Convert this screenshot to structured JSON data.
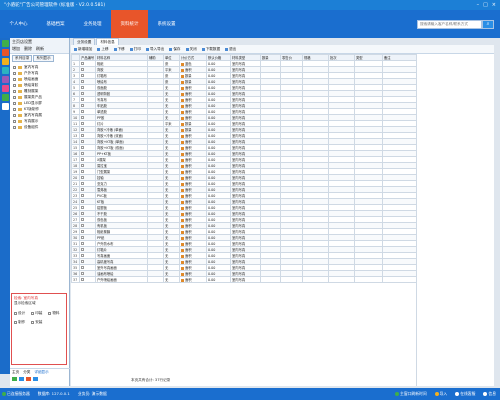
{
  "title": "\"小骆驼\"广告公司管理软件 (标准版 - V2.0.0.581)",
  "nav_tabs": [
    "个人中心",
    "基础档案",
    "业务处理",
    "资料统计",
    "系统设置"
  ],
  "nav_active": 3,
  "search_placeholder": "搜索请输入客户名称/联系方式",
  "left_toolbar": [
    "主页店设置",
    "增加",
    "删除",
    "刷新"
  ],
  "left_tabs": [
    "系列目录",
    "系列显示"
  ],
  "tree_items": [
    "室内写真",
    "户外写真",
    "喷绘画面",
    "喷绘背胶",
    "雕刻展架",
    "展架类产品",
    "LED显示屏",
    "KT版制作",
    "室内写真展",
    "写真展示",
    "设备组件"
  ],
  "filter": {
    "heading": "检索: 室内写真",
    "sub": "显示检索区域",
    "options": [
      "设计",
      "印装",
      "物料",
      "制作",
      "安装"
    ]
  },
  "left_bottom_tabs": [
    "主页",
    "分类",
    "详细显示"
  ],
  "doc_tabs": [
    "业务设置",
    "材料信息"
  ],
  "toolbar_items": [
    "新增增加",
    "上移",
    "下移",
    "打印",
    "导入导出",
    "保存",
    "关闭",
    "下载数据",
    "退出"
  ],
  "columns": [
    "",
    "产品编号",
    "材料名称",
    "辅助",
    "单位",
    "计价方式",
    "默认价格",
    "材料类型",
    "数量",
    "零售价",
    "规格",
    "批次",
    "类型",
    "备注"
  ],
  "rows": [
    [
      "1",
      "相纸",
      "张",
      "蓝色",
      "蓝色",
      "0.00",
      "室内写真"
    ],
    [
      "2",
      "背胶",
      "平米",
      "面积",
      "面积",
      "0.00",
      "室内写真"
    ],
    [
      "3",
      "灯箱布",
      "张",
      "数量",
      "数量",
      "0.00",
      "室内写真"
    ],
    [
      "4",
      "喷绘布",
      "张",
      "数量",
      "数量",
      "0.00",
      "室内写真"
    ],
    [
      "5",
      "双面胶",
      "无",
      "面积",
      "面积",
      "0.00",
      "室内写真"
    ],
    [
      "6",
      "透明背胶",
      "无",
      "面积",
      "面积",
      "0.00",
      "室内写真"
    ],
    [
      "7",
      "写真布",
      "无",
      "面积",
      "面积",
      "0.00",
      "室内写真"
    ],
    [
      "8",
      "车贴胶",
      "无",
      "面积",
      "面积",
      "0.00",
      "室内写真"
    ],
    [
      "9",
      "单透胶",
      "无",
      "面积",
      "面积",
      "0.00",
      "室内写真"
    ],
    [
      "10",
      "PP胶",
      "无",
      "面积",
      "面积",
      "0.00",
      "室内写真"
    ],
    [
      "11",
      "灯片",
      "平米",
      "数量",
      "数量",
      "0.00",
      "室内写真"
    ],
    [
      "12",
      "背胶+冷裱 (单面)",
      "无",
      "数量",
      "数量",
      "0.00",
      "室内写真"
    ],
    [
      "13",
      "背胶+冷裱 (双面)",
      "无",
      "面积",
      "面积",
      "0.00",
      "室内写真"
    ],
    [
      "14",
      "背胶+KT板 (单面)",
      "无",
      "面积",
      "面积",
      "0.00",
      "室内写真"
    ],
    [
      "15",
      "背胶+KT板 (双面)",
      "无",
      "面积",
      "面积",
      "0.00",
      "室内写真"
    ],
    [
      "16",
      "PP+KT板",
      "无",
      "面积",
      "面积",
      "0.00",
      "室内写真"
    ],
    [
      "17",
      "X展架",
      "无",
      "面积",
      "面积",
      "0.00",
      "室内写真"
    ],
    [
      "18",
      "易拉宝",
      "无",
      "面积",
      "面积",
      "0.00",
      "室内写真"
    ],
    [
      "19",
      "门型展架",
      "无",
      "面积",
      "面积",
      "0.00",
      "室内写真"
    ],
    [
      "20",
      "挂轴",
      "无",
      "面积",
      "面积",
      "0.00",
      "室内写真"
    ],
    [
      "21",
      "亚克力",
      "无",
      "面积",
      "面积",
      "0.00",
      "室内写真"
    ],
    [
      "22",
      "雪弗板",
      "无",
      "面积",
      "面积",
      "0.00",
      "室内写真"
    ],
    [
      "23",
      "PVC板",
      "无",
      "面积",
      "面积",
      "0.00",
      "室内写真"
    ],
    [
      "24",
      "KT板",
      "无",
      "面积",
      "面积",
      "0.00",
      "室内写真"
    ],
    [
      "25",
      "铝塑板",
      "无",
      "面积",
      "面积",
      "0.00",
      "室内写真"
    ],
    [
      "26",
      "不干胶",
      "无",
      "面积",
      "面积",
      "0.00",
      "室内写真"
    ],
    [
      "27",
      "双色板",
      "无",
      "面积",
      "面积",
      "0.00",
      "室内写真"
    ],
    [
      "28",
      "有机板",
      "无",
      "面积",
      "面积",
      "0.00",
      "室内写真"
    ],
    [
      "29",
      "相纸覆膜",
      "无",
      "面积",
      "面积",
      "0.00",
      "室内写真"
    ],
    [
      "30",
      "PP纸",
      "无",
      "面积",
      "面积",
      "0.00",
      "室内写真"
    ],
    [
      "31",
      "户外防水布",
      "无",
      "面积",
      "面积",
      "0.00",
      "室内写真"
    ],
    [
      "32",
      "灯箱片",
      "无",
      "面积",
      "面积",
      "0.00",
      "室内写真"
    ],
    [
      "33",
      "写真画面",
      "无",
      "面积",
      "面积",
      "0.00",
      "室内写真"
    ],
    [
      "34",
      "高精度写真",
      "无",
      "面积",
      "面积",
      "0.00",
      "室内写真"
    ],
    [
      "35",
      "室外写真画面",
      "无",
      "面积",
      "面积",
      "0.00",
      "室内写真"
    ],
    [
      "36",
      "油画布喷绘",
      "无",
      "面积",
      "面积",
      "0.00",
      "室内写真"
    ],
    [
      "37",
      "户外喷绘画面",
      "无",
      "面积",
      "面积",
      "0.00",
      "室内写真"
    ]
  ],
  "grid_footer": "本页共有合计: 37行记录",
  "status": [
    "已连接服务器",
    "数据库: 127.0.0.1",
    "业务员: 演示数据",
    "主窗口刷新时间",
    "导入",
    "在线客服",
    "信息"
  ],
  "colors": {
    "blue": "#1a6ecf",
    "accent": "#e8552a",
    "swatch": "#e08a2a"
  }
}
